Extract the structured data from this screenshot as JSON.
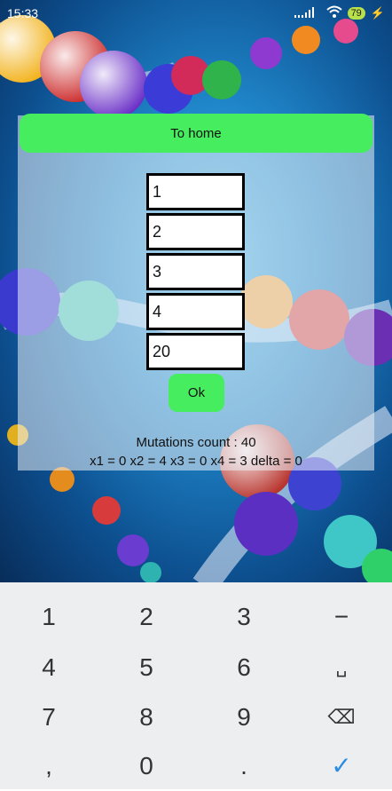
{
  "status": {
    "time": "15:33",
    "battery": "79"
  },
  "home_button": "To home",
  "fields": [
    "1",
    "2",
    "3",
    "4",
    "20"
  ],
  "ok_button": "Ok",
  "results": {
    "mutations": "Mutations count : 40",
    "solution": "x1 = 0 x2 = 4 x3 = 0 x4 = 3 delta = 0"
  },
  "keyboard": {
    "keys": [
      "1",
      "2",
      "3",
      "−",
      "4",
      "5",
      "6",
      "␣",
      "7",
      "8",
      "9",
      "⌫",
      ",",
      "0",
      ".",
      "✓"
    ]
  }
}
